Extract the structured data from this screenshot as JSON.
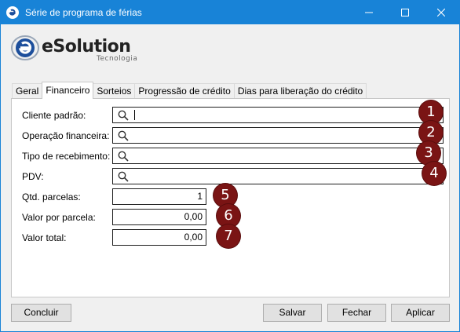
{
  "window": {
    "title": "Série de programa de férias"
  },
  "logo": {
    "brand": "eSolution",
    "subtitle": "Tecnologia"
  },
  "tabs": [
    {
      "label": "Geral"
    },
    {
      "label": "Financeiro"
    },
    {
      "label": "Sorteios"
    },
    {
      "label": "Progressão de crédito"
    },
    {
      "label": "Dias para liberação do crédito"
    }
  ],
  "form": {
    "cliente_padrao": {
      "label": "Cliente padrão:",
      "value": ""
    },
    "operacao_financeira": {
      "label": "Operação financeira:",
      "value": ""
    },
    "tipo_recebimento": {
      "label": "Tipo de recebimento:",
      "value": ""
    },
    "pdv": {
      "label": "PDV:",
      "value": ""
    },
    "qtd_parcelas": {
      "label": "Qtd. parcelas:",
      "value": "1"
    },
    "valor_parcela": {
      "label": "Valor por parcela:",
      "value": "0,00"
    },
    "valor_total": {
      "label": "Valor total:",
      "value": "0,00"
    }
  },
  "callouts": [
    "1",
    "2",
    "3",
    "4",
    "5",
    "6",
    "7"
  ],
  "buttons": {
    "concluir": "Concluir",
    "salvar": "Salvar",
    "fechar": "Fechar",
    "aplicar": "Aplicar"
  },
  "colors": {
    "titlebar": "#1883d7",
    "badge": "#7a1414",
    "logo_blue": "#1d4f9c"
  }
}
